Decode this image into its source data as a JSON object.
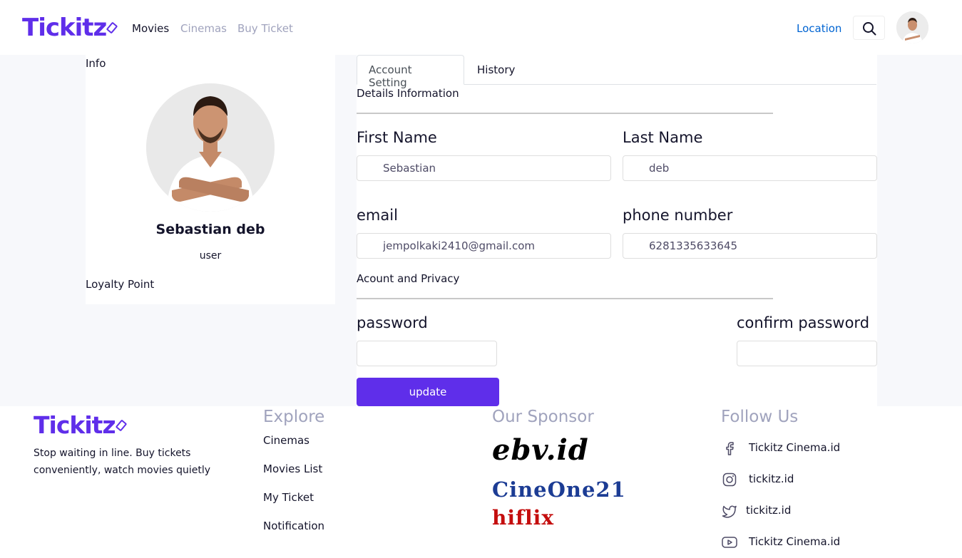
{
  "brand": {
    "name": "Tickitz",
    "color": "#5f2eea"
  },
  "navbar": {
    "links": [
      {
        "label": "Movies",
        "active": true
      },
      {
        "label": "Cinemas",
        "active": false
      },
      {
        "label": "Buy Ticket",
        "active": false
      }
    ],
    "location_label": "Location",
    "search_icon": "search-icon",
    "avatar_icon": "user-avatar"
  },
  "profile": {
    "info_label": "Info",
    "name": "Sebastian deb",
    "role": "user",
    "loyalty_label": "Loyalty Point"
  },
  "tabs": [
    {
      "label": "Account Setting",
      "active": true
    },
    {
      "label": "History",
      "active": false
    }
  ],
  "details": {
    "section_title": "Details Information",
    "first_name_label": "First Name",
    "first_name_value": "Sebastian",
    "last_name_label": "Last Name",
    "last_name_value": "deb",
    "email_label": "email",
    "email_value": "jempolkaki2410@gmail.com",
    "phone_label": "phone number",
    "phone_value": "6281335633645"
  },
  "privacy": {
    "section_title": "Acount and Privacy",
    "password_label": "password",
    "password_value": "",
    "confirm_label": "confirm password",
    "confirm_value": ""
  },
  "update_button": "update",
  "footer": {
    "tagline": "Stop waiting in line. Buy tickets conveniently, watch movies quietly",
    "explore": {
      "heading": "Explore",
      "links": [
        "Cinemas",
        "Movies List",
        "My Ticket",
        "Notification"
      ]
    },
    "sponsor": {
      "heading": "Our Sponsor",
      "names": [
        "ebv.id",
        "CineOne21",
        "hiflix"
      ]
    },
    "follow": {
      "heading": "Follow Us",
      "items": [
        {
          "icon": "facebook-icon",
          "label": "Tickitz Cinema.id"
        },
        {
          "icon": "instagram-icon",
          "label": "tickitz.id"
        },
        {
          "icon": "twitter-icon",
          "label": "tickitz.id"
        },
        {
          "icon": "youtube-icon",
          "label": "Tickitz Cinema.id"
        }
      ]
    }
  }
}
